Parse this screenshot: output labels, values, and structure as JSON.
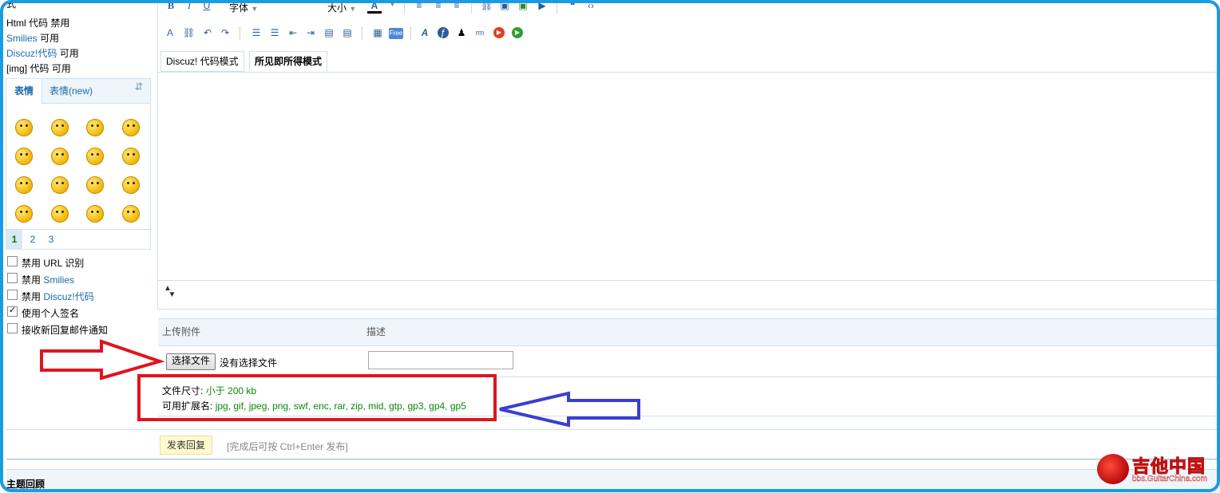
{
  "options": {
    "title_fragment": "式",
    "html": {
      "label": "Html 代码",
      "state": "禁用"
    },
    "smilies": {
      "label": "Smilies",
      "state": "可用"
    },
    "discuz": {
      "label": "Discuz!代码",
      "state": "可用"
    },
    "img": {
      "label": "[img] 代码",
      "state": "可用"
    }
  },
  "smiley_panel": {
    "tabs": [
      "表情",
      "表情(new)"
    ],
    "pages": [
      "1",
      "2",
      "3"
    ],
    "current_page": "1"
  },
  "checkboxes": [
    {
      "prefix": "禁用",
      "label": "URL 识别",
      "checked": false
    },
    {
      "prefix": "禁用",
      "label": "Smilies",
      "checked": false
    },
    {
      "prefix": "禁用",
      "label": "Discuz!代码",
      "checked": false
    },
    {
      "prefix": "",
      "label": "使用个人签名",
      "checked": true
    },
    {
      "prefix": "",
      "label": "接收新回复邮件通知",
      "checked": false
    }
  ],
  "toolbar": {
    "bold": "B",
    "italic": "I",
    "underline": "U",
    "font_label": "字体",
    "size_label": "大小",
    "color_label": "A"
  },
  "mode_tabs": [
    "Discuz! 代码模式",
    "所见即所得模式"
  ],
  "attachment": {
    "col_upload": "上传附件",
    "col_desc": "描述",
    "file_button": "选择文件",
    "no_file": "没有选择文件",
    "size_label": "文件尺寸:",
    "size_value": "小于 200 kb",
    "ext_label": "可用扩展名:",
    "ext_value": "jpg, gif, jpeg, png, swf, enc, rar, zip, mid, gtp, gp3, gp4, gp5"
  },
  "submit": {
    "button": "发表回复",
    "hint": "[完成后可按 Ctrl+Enter 发布]"
  },
  "bottom_title": "主题回顾",
  "watermark": {
    "text": "吉他中国",
    "url": "bbs.GuitarChina.com"
  },
  "colors": {
    "frame": "#1a9be6",
    "red_annotation": "#e0141e",
    "blue_annotation": "#3a3fd0",
    "green_text": "#0a8a0a"
  }
}
